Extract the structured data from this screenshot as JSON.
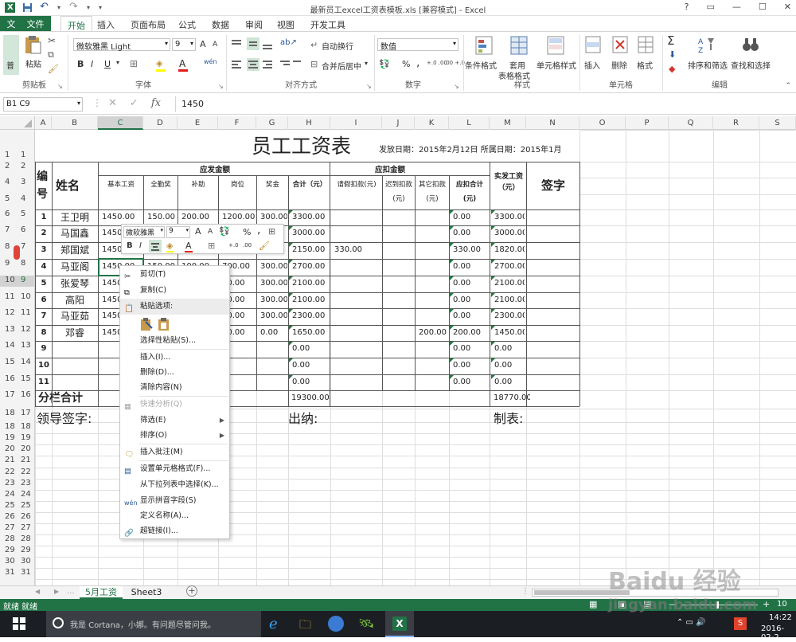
{
  "window": {
    "title": "最新员工excel工资表模板.xls  [兼容模式] - Excel",
    "controls": [
      "?",
      "▭",
      "—",
      "☐",
      "✕"
    ]
  },
  "tabs": {
    "file": "文件",
    "file_badge": "文",
    "items": [
      "开始",
      "插入",
      "页面布局",
      "公式",
      "数据",
      "审阅",
      "视图",
      "开发工具"
    ],
    "active": "开始"
  },
  "ribbon": {
    "clipboard": {
      "label": "剪贴板",
      "paste": "粘贴",
      "paste_badge": "普"
    },
    "font": {
      "label": "字体",
      "font_name": "微软雅黑 Light",
      "font_size": "9",
      "bold": "B",
      "italic": "I",
      "underline": "U",
      "grow": "A",
      "shrink": "A",
      "wen": "wén",
      "text_color_glyph": "A"
    },
    "align": {
      "label": "对齐方式",
      "wrap": "自动换行",
      "merge": "合并后居中"
    },
    "number": {
      "label": "数字",
      "format": "数值",
      "percent": "%",
      "comma": ",",
      "inc": "+.0 .00",
      "dec": ".00 +.0"
    },
    "styles": {
      "label": "样式",
      "cond": "条件格式",
      "table1": "套用",
      "table2": "表格格式",
      "cell": "单元格样式"
    },
    "cells": {
      "label": "单元格",
      "insert": "插入",
      "delete": "删除",
      "format": "格式"
    },
    "edit": {
      "label": "编辑",
      "sum": "Σ",
      "sort": "排序和筛选",
      "find": "查找和选择"
    }
  },
  "formula_bar": {
    "name_box": "B1  C9",
    "fx": "fx",
    "cancel": "✕",
    "enter": "✓",
    "value": "1450"
  },
  "columns": [
    "A",
    "B",
    "C",
    "D",
    "E",
    "F",
    "G",
    "H",
    "I",
    "J",
    "K",
    "L",
    "M",
    "N",
    "O",
    "P",
    "Q",
    "R",
    "S"
  ],
  "selected_column": "C",
  "sheet": {
    "title": "员工工资表",
    "issue_date": "发放日期：2015年2月12日 所属日期：2015年1月",
    "hdr_no": "编号",
    "hdr_name": "姓名",
    "hdr_payable": "应发金额",
    "hdr_deduct": "应扣金额",
    "hdr_net": "实发工资（元）",
    "hdr_sign": "签字",
    "sub_headers": [
      "基本工资",
      "全勤奖",
      "补助",
      "岗位",
      "奖金",
      "合计（元）",
      "请假扣款(元)",
      "迟到扣款(元)",
      "其它扣款(元)",
      "应扣合计(元)"
    ],
    "rows": [
      {
        "no": "1",
        "name": "王卫明",
        "base": "1450.00",
        "attend": "150.00",
        "allow": "200.00",
        "post": "1200.00",
        "bonus": "300.00",
        "total": "3300.00",
        "leave": "",
        "late": "",
        "other": "",
        "ded": "0.00",
        "net": "3300.00"
      },
      {
        "no": "2",
        "name": "马国鑫",
        "base": "1450",
        "attend": "",
        "allow": "",
        "post": "",
        "bonus": "",
        "total": "3000.00",
        "leave": "",
        "late": "",
        "other": "",
        "ded": "0.00",
        "net": "3000.00"
      },
      {
        "no": "3",
        "name": "郑国斌",
        "base": "1450",
        "attend": "",
        "allow": "",
        "post": "",
        "bonus": "",
        "total": "2150.00",
        "leave": "330.00",
        "late": "",
        "other": "",
        "ded": "330.00",
        "net": "1820.00"
      },
      {
        "no": "4",
        "name": "马亚阁",
        "base": "1450.00",
        "attend": "150.00",
        "allow": "100.00",
        "post": "700.00",
        "bonus": "300.00",
        "total": "2700.00",
        "leave": "",
        "late": "",
        "other": "",
        "ded": "0.00",
        "net": "2700.00"
      },
      {
        "no": "5",
        "name": "张爱琴",
        "base": "1450",
        "attend": "",
        "allow": "",
        "post": "00.00",
        "bonus": "300.00",
        "total": "2100.00",
        "leave": "",
        "late": "",
        "other": "",
        "ded": "0.00",
        "net": "2100.00"
      },
      {
        "no": "6",
        "name": "高阳",
        "base": "1450",
        "attend": "",
        "allow": "",
        "post": "00.00",
        "bonus": "300.00",
        "total": "2100.00",
        "leave": "",
        "late": "",
        "other": "",
        "ded": "0.00",
        "net": "2100.00"
      },
      {
        "no": "7",
        "name": "马亚茹",
        "base": "1450",
        "attend": "",
        "allow": "",
        "post": "00.00",
        "bonus": "300.00",
        "total": "2300.00",
        "leave": "",
        "late": "",
        "other": "",
        "ded": "0.00",
        "net": "2300.00"
      },
      {
        "no": "8",
        "name": "邓睿",
        "base": "1450",
        "attend": "",
        "allow": "",
        "post": "00.00",
        "bonus": "0.00",
        "total": "1650.00",
        "leave": "",
        "late": "",
        "other": "200.00",
        "ded": "200.00",
        "net": "1450.00"
      },
      {
        "no": "9",
        "name": "",
        "base": "",
        "attend": "",
        "allow": "",
        "post": "",
        "bonus": "",
        "total": "0.00",
        "leave": "",
        "late": "",
        "other": "",
        "ded": "0.00",
        "net": "0.00"
      },
      {
        "no": "10",
        "name": "",
        "base": "",
        "attend": "",
        "allow": "",
        "post": "",
        "bonus": "",
        "total": "0.00",
        "leave": "",
        "late": "",
        "other": "",
        "ded": "0.00",
        "net": "0.00"
      },
      {
        "no": "11",
        "name": "",
        "base": "",
        "attend": "",
        "allow": "",
        "post": "",
        "bonus": "",
        "total": "0.00",
        "leave": "",
        "late": "",
        "other": "",
        "ded": "0.00",
        "net": "0.00"
      }
    ],
    "subtotal_label": "分栏合计",
    "subtotal_total": "19300.00",
    "subtotal_net": "18770.00",
    "sig_leader": "领导签字:",
    "sig_cashier": "出纳:",
    "sig_maker": "制表:"
  },
  "row_headers": [
    {
      "a": "1",
      "b": "1"
    },
    {
      "a": "2",
      "b": "2"
    },
    {
      "a": "4",
      "b": "3"
    },
    {
      "a": "5",
      "b": "4"
    },
    {
      "a": "6",
      "b": "5"
    },
    {
      "a": "7",
      "b": "6"
    },
    {
      "a": "8",
      "b": "7"
    },
    {
      "a": "9",
      "b": "8"
    },
    {
      "a": "10",
      "b": "9"
    },
    {
      "a": "11",
      "b": "10"
    },
    {
      "a": "12",
      "b": "11"
    },
    {
      "a": "13",
      "b": "12"
    },
    {
      "a": "14",
      "b": "13"
    },
    {
      "a": "15",
      "b": "14"
    },
    {
      "a": "16",
      "b": "15"
    },
    {
      "a": "17",
      "b": "16"
    },
    {
      "a": "18",
      "b": "17"
    },
    {
      "a": "18",
      "b": "18"
    },
    {
      "a": "19",
      "b": "19"
    },
    {
      "a": "20",
      "b": "20"
    },
    {
      "a": "21",
      "b": "21"
    },
    {
      "a": "22",
      "b": "22"
    },
    {
      "a": "23",
      "b": "23"
    },
    {
      "a": "24",
      "b": "24"
    },
    {
      "a": "25",
      "b": "25"
    },
    {
      "a": "26",
      "b": "26"
    },
    {
      "a": "27",
      "b": "27"
    },
    {
      "a": "28",
      "b": "28"
    },
    {
      "a": "29",
      "b": "29"
    },
    {
      "a": "30",
      "b": "30"
    },
    {
      "a": "31",
      "b": "31"
    }
  ],
  "mini_toolbar": {
    "font": "微软雅黑",
    "size": "9",
    "grow": "A",
    "shrink": "A",
    "percent": "%",
    "comma": ",",
    "bold": "B",
    "italic": "I",
    "font_color": "A",
    "inc": "+.0",
    "dec": ".00"
  },
  "context_menu": [
    "剪切(T)",
    "复制(C)",
    "粘贴选项:",
    "选择性粘贴(S)...",
    "插入(I)...",
    "删除(D)...",
    "清除内容(N)",
    "快速分析(Q)",
    "筛选(E)",
    "排序(O)",
    "插入批注(M)",
    "设置单元格格式(F)...",
    "从下拉列表中选择(K)...",
    "显示拼音字段(S)",
    "定义名称(A)...",
    "超链接(I)..."
  ],
  "sheet_tabs": {
    "active": "5月工资",
    "other": "Sheet3",
    "add": "+",
    "nav_prev": "◀",
    "nav_next": "▶",
    "more": "..."
  },
  "status": {
    "text": "就绪 就绪",
    "zoom": "10"
  },
  "taskbar": {
    "search": "我是 Cortana，小娜。有问题尽管问我。",
    "time": "14:22",
    "date": "2016-02-2"
  },
  "watermark": {
    "text1": "Baidu 经验",
    "text2": "jingyan.baidu.com"
  },
  "colors": {
    "excel_green": "#217346",
    "header_bg": "#f3f3f3",
    "taskbar": "#1b1f24"
  }
}
